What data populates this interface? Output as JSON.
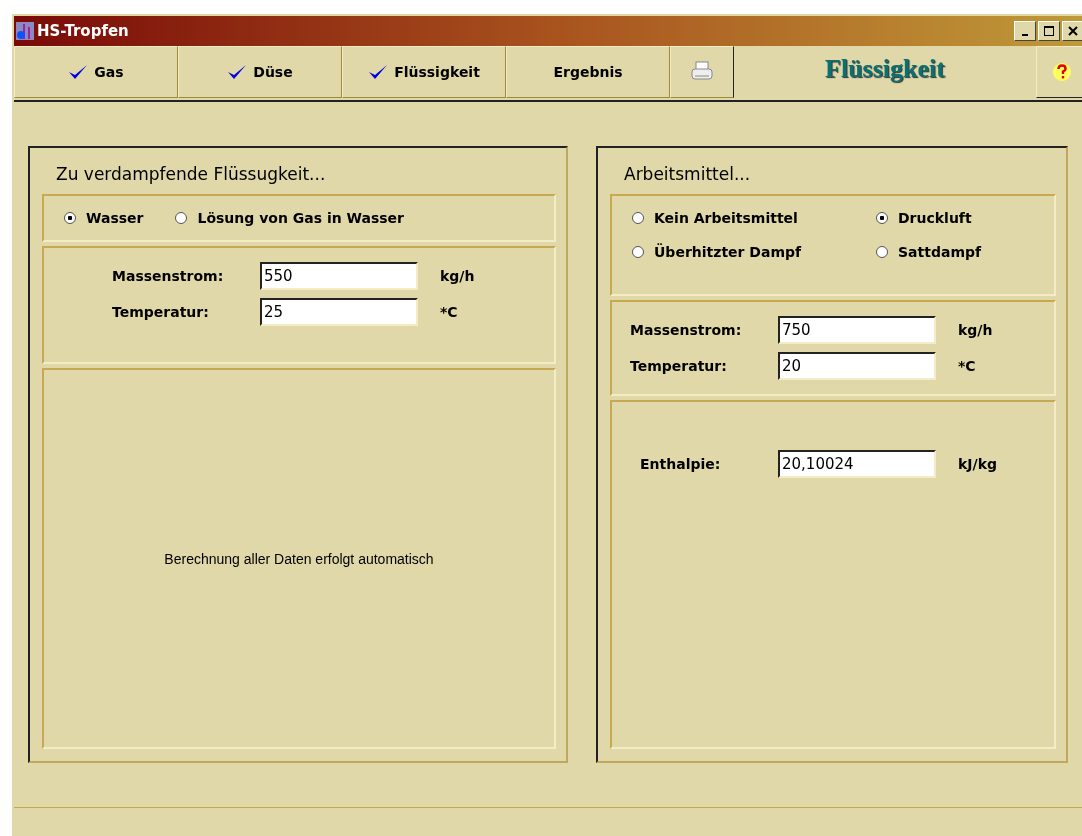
{
  "window": {
    "title": "HS-Tropfen"
  },
  "tabs": [
    {
      "label": "Gas",
      "checked": true
    },
    {
      "label": "Düse",
      "checked": true
    },
    {
      "label": "Flüssigkeit",
      "checked": true
    },
    {
      "label": "Ergebnis",
      "checked": false
    }
  ],
  "page_heading": "Flüssigkeit",
  "left_panel": {
    "title": "Zu verdampfende Flüssugkeit...",
    "options": [
      {
        "label": "Wasser",
        "selected": true
      },
      {
        "label": "Lösung von Gas in Wasser",
        "selected": false
      }
    ],
    "fields": [
      {
        "label": "Massenstrom:",
        "value": "550",
        "unit": "kg/h"
      },
      {
        "label": "Temperatur:",
        "value": "25",
        "unit": "*C"
      }
    ],
    "note": "Berechnung aller Daten erfolgt automatisch"
  },
  "right_panel": {
    "title": "Arbeitsmittel...",
    "options": [
      {
        "label": "Kein Arbeitsmittel",
        "selected": false
      },
      {
        "label": "Druckluft",
        "selected": true
      },
      {
        "label": "Überhitzter Dampf",
        "selected": false
      },
      {
        "label": "Sattdampf",
        "selected": false
      }
    ],
    "fields": [
      {
        "label": "Massenstrom:",
        "value": "750",
        "unit": "kg/h"
      },
      {
        "label": "Temperatur:",
        "value": "20",
        "unit": "*C"
      }
    ],
    "enthalpy": {
      "label": "Enthalpie:",
      "value": "20,10024",
      "unit": "kJ/kg"
    }
  }
}
